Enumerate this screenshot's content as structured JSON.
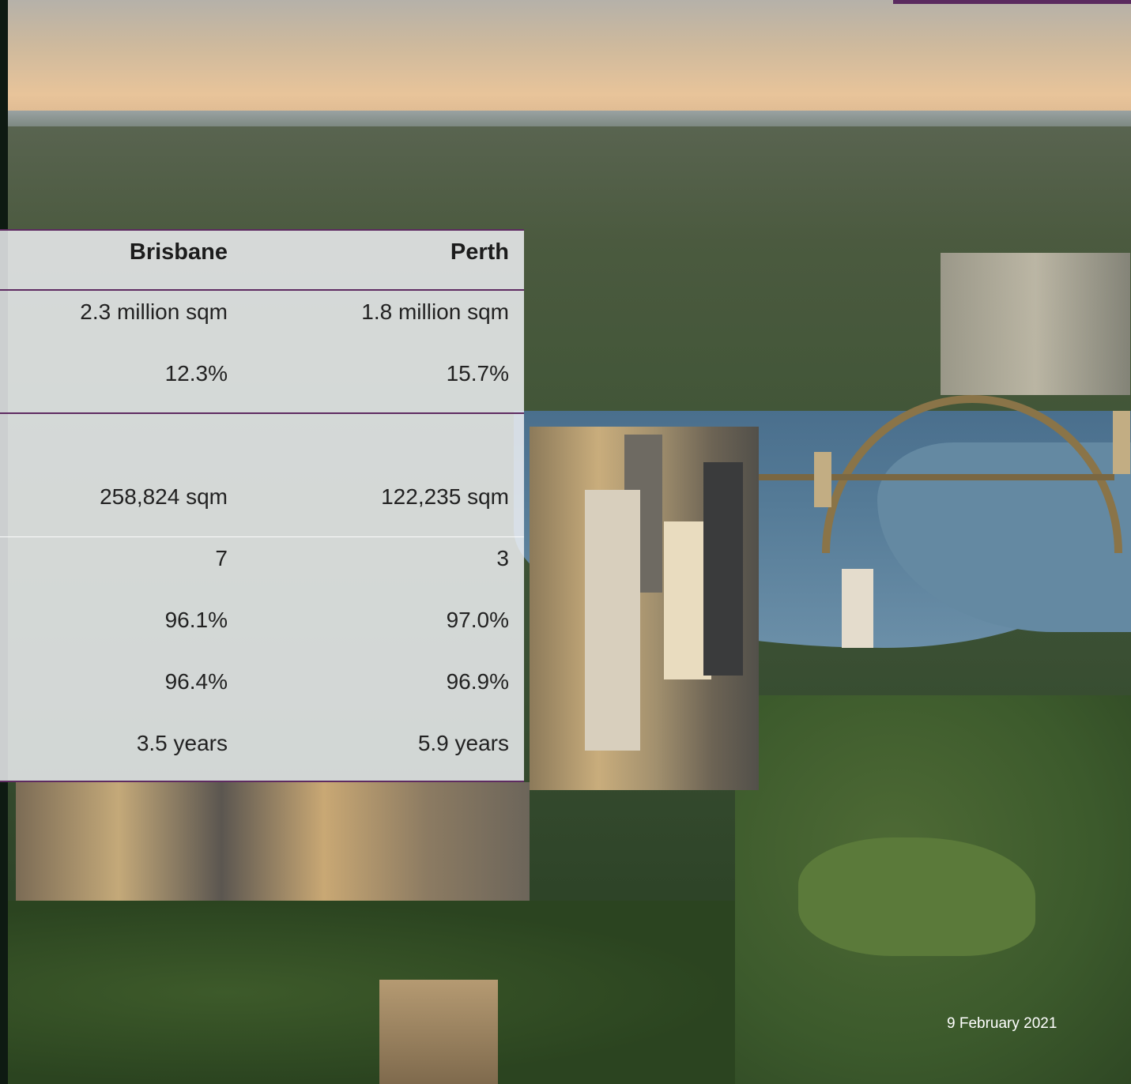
{
  "table": {
    "headers": [
      "Brisbane",
      "Perth"
    ],
    "rows": [
      [
        "2.3 million sqm",
        "1.8 million sqm"
      ],
      [
        "12.3%",
        "15.7%"
      ],
      [
        "258,824 sqm",
        "122,235 sqm"
      ],
      [
        "7",
        "3"
      ],
      [
        "96.1%",
        "97.0%"
      ],
      [
        "96.4%",
        "96.9%"
      ],
      [
        "3.5 years",
        "5.9 years"
      ]
    ]
  },
  "footer": {
    "date": "9 February 2021"
  },
  "colors": {
    "accent": "#5e2b61",
    "panel": "#f1f2f6"
  }
}
